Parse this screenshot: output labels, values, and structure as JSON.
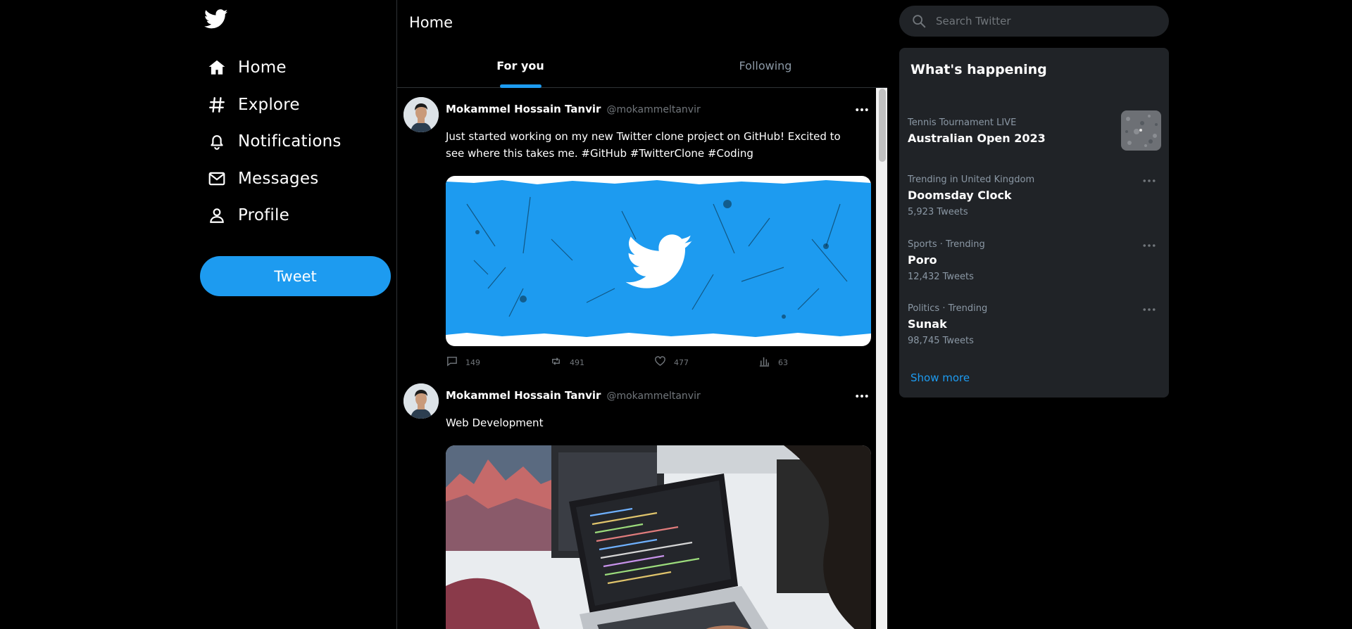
{
  "nav": {
    "logo": "twitter-bird-icon",
    "items": [
      {
        "label": "Home",
        "icon": "home-icon"
      },
      {
        "label": "Explore",
        "icon": "hashtag-icon"
      },
      {
        "label": "Notifications",
        "icon": "bell-icon"
      },
      {
        "label": "Messages",
        "icon": "mail-icon"
      },
      {
        "label": "Profile",
        "icon": "person-icon"
      }
    ],
    "tweet_button": "Tweet"
  },
  "timeline": {
    "title": "Home",
    "tabs": [
      {
        "label": "For you",
        "active": true
      },
      {
        "label": "Following",
        "active": false
      }
    ],
    "tweets": [
      {
        "author": "Mokammel Hossain Tanvir",
        "handle": "@mokammeltanvir",
        "text": "Just started working on my new Twitter clone project on GitHub! Excited to see where this takes me. #GitHub #TwitterClone #Coding",
        "media": "twitter-logo-banner",
        "stats": {
          "replies": "149",
          "retweets": "491",
          "likes": "477",
          "views": "63"
        }
      },
      {
        "author": "Mokammel Hossain Tanvir",
        "handle": "@mokammeltanvir",
        "text": "Web Development",
        "media": "laptop-code-photo"
      }
    ]
  },
  "sidebar": {
    "search_placeholder": "Search Twitter",
    "trends_title": "What's happening",
    "trends": [
      {
        "context": "Tennis Tournament LIVE",
        "title": "Australian Open 2023",
        "count": "",
        "has_image": true
      },
      {
        "context": "Trending in United Kingdom",
        "title": "Doomsday Clock",
        "count": "5,923 Tweets"
      },
      {
        "context": "Sports · Trending",
        "title": "Poro",
        "count": "12,432 Tweets"
      },
      {
        "context": "Politics · Trending",
        "title": "Sunak",
        "count": "98,745 Tweets"
      }
    ],
    "show_more": "Show more"
  },
  "colors": {
    "accent": "#1d9bf0",
    "background": "#000000",
    "panel": "#202327",
    "muted": "#71767b"
  }
}
